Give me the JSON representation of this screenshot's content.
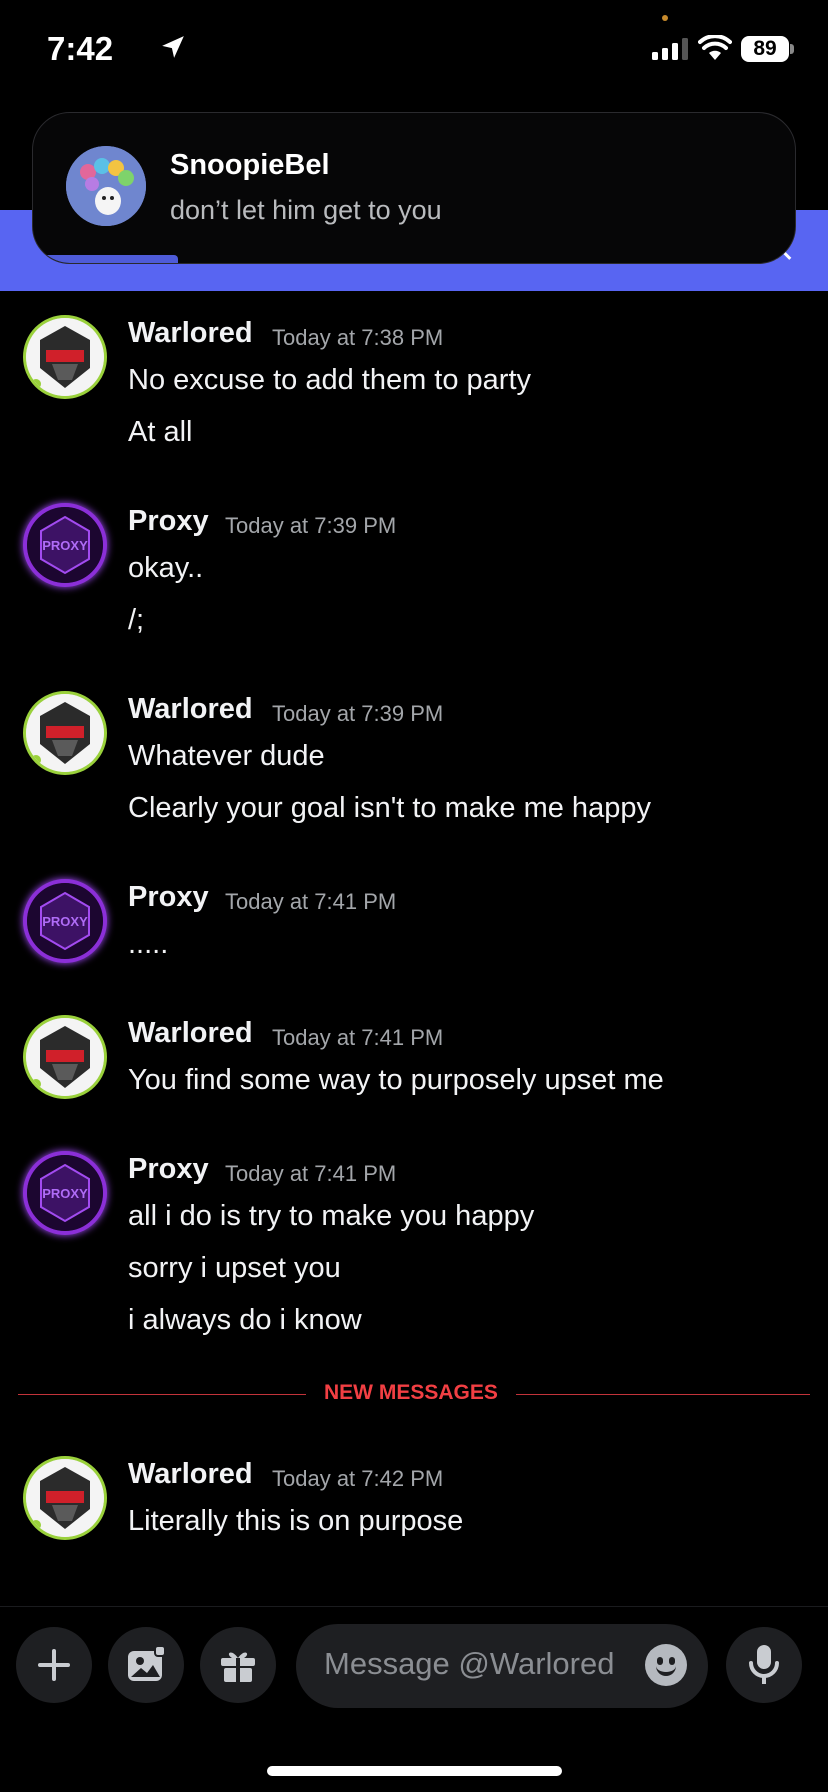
{
  "status_bar": {
    "time": "7:42",
    "battery": "89"
  },
  "notification": {
    "sender": "SnoopieBel",
    "text": "don’t let him get to you"
  },
  "messages": [
    {
      "author": "Warlored",
      "timestamp": "Today at 7:38 PM",
      "lines": [
        "No excuse to add them to party",
        "At all"
      ]
    },
    {
      "author": "Proxy",
      "timestamp": "Today at 7:39 PM",
      "lines": [
        "okay..",
        "/;"
      ]
    },
    {
      "author": "Warlored",
      "timestamp": "Today at 7:39 PM",
      "lines": [
        "Whatever dude",
        "Clearly your goal isn't to make me happy"
      ]
    },
    {
      "author": "Proxy",
      "timestamp": "Today at 7:41 PM",
      "lines": [
        "....."
      ]
    },
    {
      "author": "Warlored",
      "timestamp": "Today at 7:41 PM",
      "lines": [
        "You find some way to purposely upset me"
      ]
    },
    {
      "author": "Proxy",
      "timestamp": "Today at 7:41 PM",
      "lines": [
        "all i do is try to make you happy",
        "sorry i upset you",
        "i always do i know"
      ]
    },
    {
      "author": "Warlored",
      "timestamp": "Today at 7:42 PM",
      "lines": [
        "Literally this is on purpose"
      ]
    }
  ],
  "divider": {
    "label": "NEW MESSAGES"
  },
  "composer": {
    "placeholder": "Message @Warlored"
  },
  "colors": {
    "accent": "#5865f2",
    "new_messages": "#f23f43",
    "background": "#000000"
  },
  "icons": [
    "location-arrow-icon",
    "signal-icon",
    "wifi-icon",
    "battery-icon",
    "close-icon",
    "plus-icon",
    "image-icon",
    "gift-icon",
    "emoji-icon",
    "microphone-icon"
  ]
}
